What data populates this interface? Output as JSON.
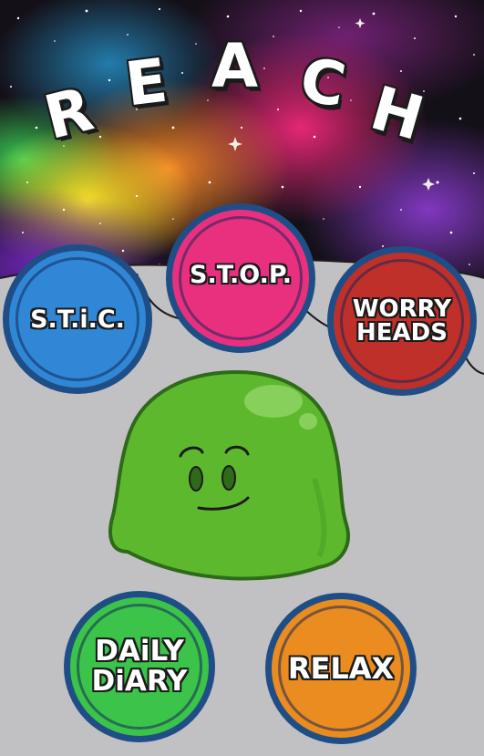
{
  "app": {
    "title_letters": [
      "R",
      "E",
      "A",
      "C",
      "H"
    ]
  },
  "buttons": {
    "stic": {
      "label": "S.T.i.C.",
      "color": "#2f87d6"
    },
    "stop": {
      "label": "S.T.O.P.",
      "color": "#e8307f"
    },
    "worry_heads": {
      "label_line1": "WORRY",
      "label_line2": "HEADS",
      "color": "#c0302a"
    },
    "daily_diary": {
      "label_line1": "DAiLY",
      "label_line2": "DiARY",
      "color": "#3cc34a"
    },
    "relax": {
      "label": "RELAX",
      "color": "#ea8c1f"
    }
  },
  "colors": {
    "ring": "#1f4e86",
    "mascot": "#5db82e",
    "background": "#b4b4b8"
  },
  "icons": {
    "mascot": "green-blob-mascot"
  }
}
